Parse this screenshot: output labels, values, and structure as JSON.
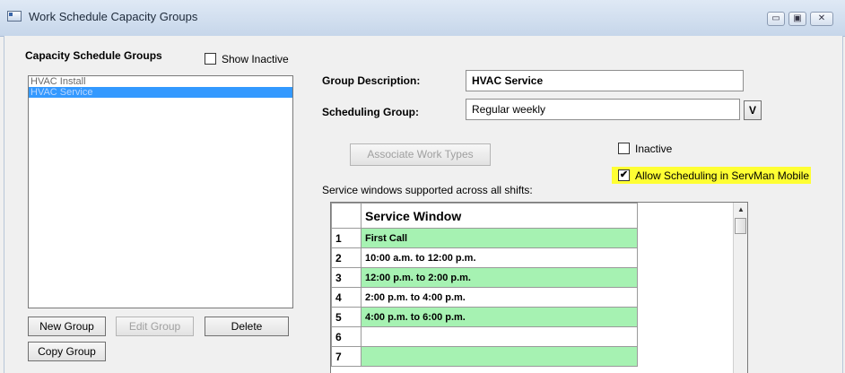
{
  "window": {
    "title": "Work Schedule Capacity Groups",
    "minimize_glyph": "▭",
    "maximize_glyph": "▣",
    "close_glyph": "✕"
  },
  "left_panel": {
    "heading": "Capacity Schedule Groups",
    "show_inactive_label": "Show Inactive",
    "show_inactive_checked": false,
    "groups": [
      {
        "label": "HVAC Install",
        "selected": false
      },
      {
        "label": "HVAC Service",
        "selected": true
      }
    ],
    "buttons": {
      "new_group": "New Group",
      "edit_group": "Edit Group",
      "delete": "Delete",
      "copy_group": "Copy Group"
    }
  },
  "detail": {
    "group_description_label": "Group Description:",
    "group_description_value": "HVAC Service",
    "scheduling_group_label": "Scheduling Group:",
    "scheduling_group_value": "Regular weekly",
    "scheduling_group_button": "V",
    "associate_work_types_button": "Associate Work Types",
    "inactive_label": "Inactive",
    "inactive_checked": false,
    "allow_mobile_label": "Allow Scheduling in ServMan Mobile",
    "allow_mobile_checked": true,
    "service_windows_caption": "Service windows supported across all shifts:",
    "highlight_color": "#ffff33"
  },
  "grid": {
    "column_header": "Service Window",
    "row_color_green": "#a6f2b2",
    "rows": [
      {
        "num": "1",
        "value": "First Call",
        "green": true
      },
      {
        "num": "2",
        "value": "10:00 a.m. to 12:00 p.m.",
        "green": false
      },
      {
        "num": "3",
        "value": "12:00 p.m. to 2:00 p.m.",
        "green": true
      },
      {
        "num": "4",
        "value": "2:00 p.m. to 4:00 p.m.",
        "green": false
      },
      {
        "num": "5",
        "value": "4:00 p.m. to 6:00 p.m.",
        "green": true
      },
      {
        "num": "6",
        "value": "",
        "green": false
      },
      {
        "num": "7",
        "value": "",
        "green": true
      }
    ]
  }
}
